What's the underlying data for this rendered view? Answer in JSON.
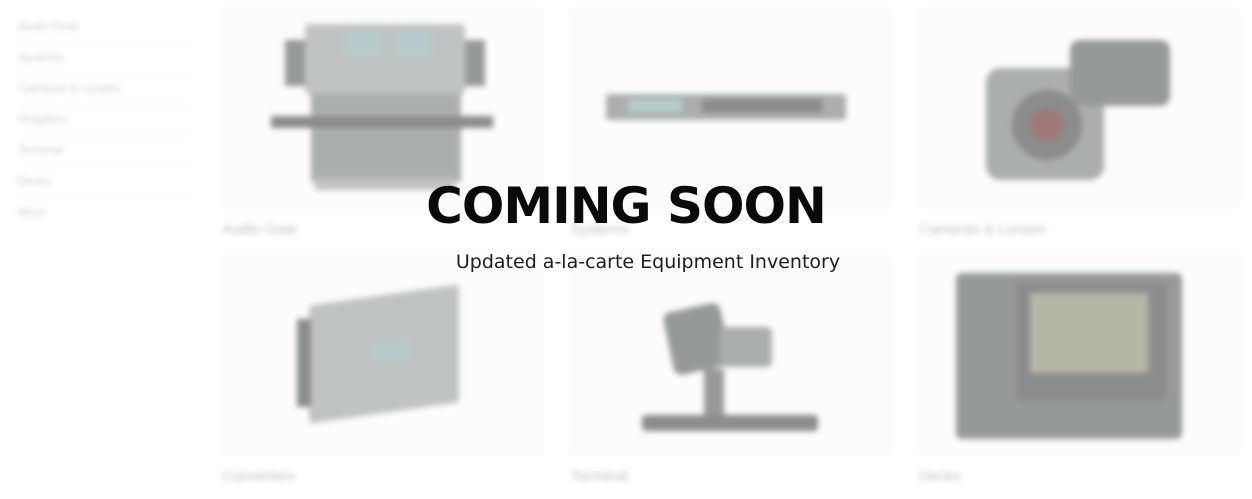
{
  "sidebar": {
    "items": [
      {
        "label": "Audio Gear"
      },
      {
        "label": "Systems"
      },
      {
        "label": "Cameras & Lenses"
      },
      {
        "label": "Graphics"
      },
      {
        "label": "Terminal"
      },
      {
        "label": "Decks"
      },
      {
        "label": "More"
      }
    ]
  },
  "grid": {
    "cards": [
      {
        "label": "Audio Gear",
        "icon": "audio-mixer-icon"
      },
      {
        "label": "Systems",
        "icon": "rack-unit-icon"
      },
      {
        "label": "Cameras & Lenses",
        "icon": "camera-lens-icon"
      },
      {
        "label": "Converters",
        "icon": "converter-box-icon"
      },
      {
        "label": "Terminal",
        "icon": "pan-tilt-head-icon"
      },
      {
        "label": "Decks",
        "icon": "monitor-deck-icon"
      }
    ]
  },
  "overlay": {
    "headline": "COMING SOON",
    "subline": "Updated a-la-carte Equipment Inventory"
  },
  "colors": {
    "headline": "#0a0a0a",
    "muted_text": "#a9a9a9",
    "background": "#ffffff"
  }
}
